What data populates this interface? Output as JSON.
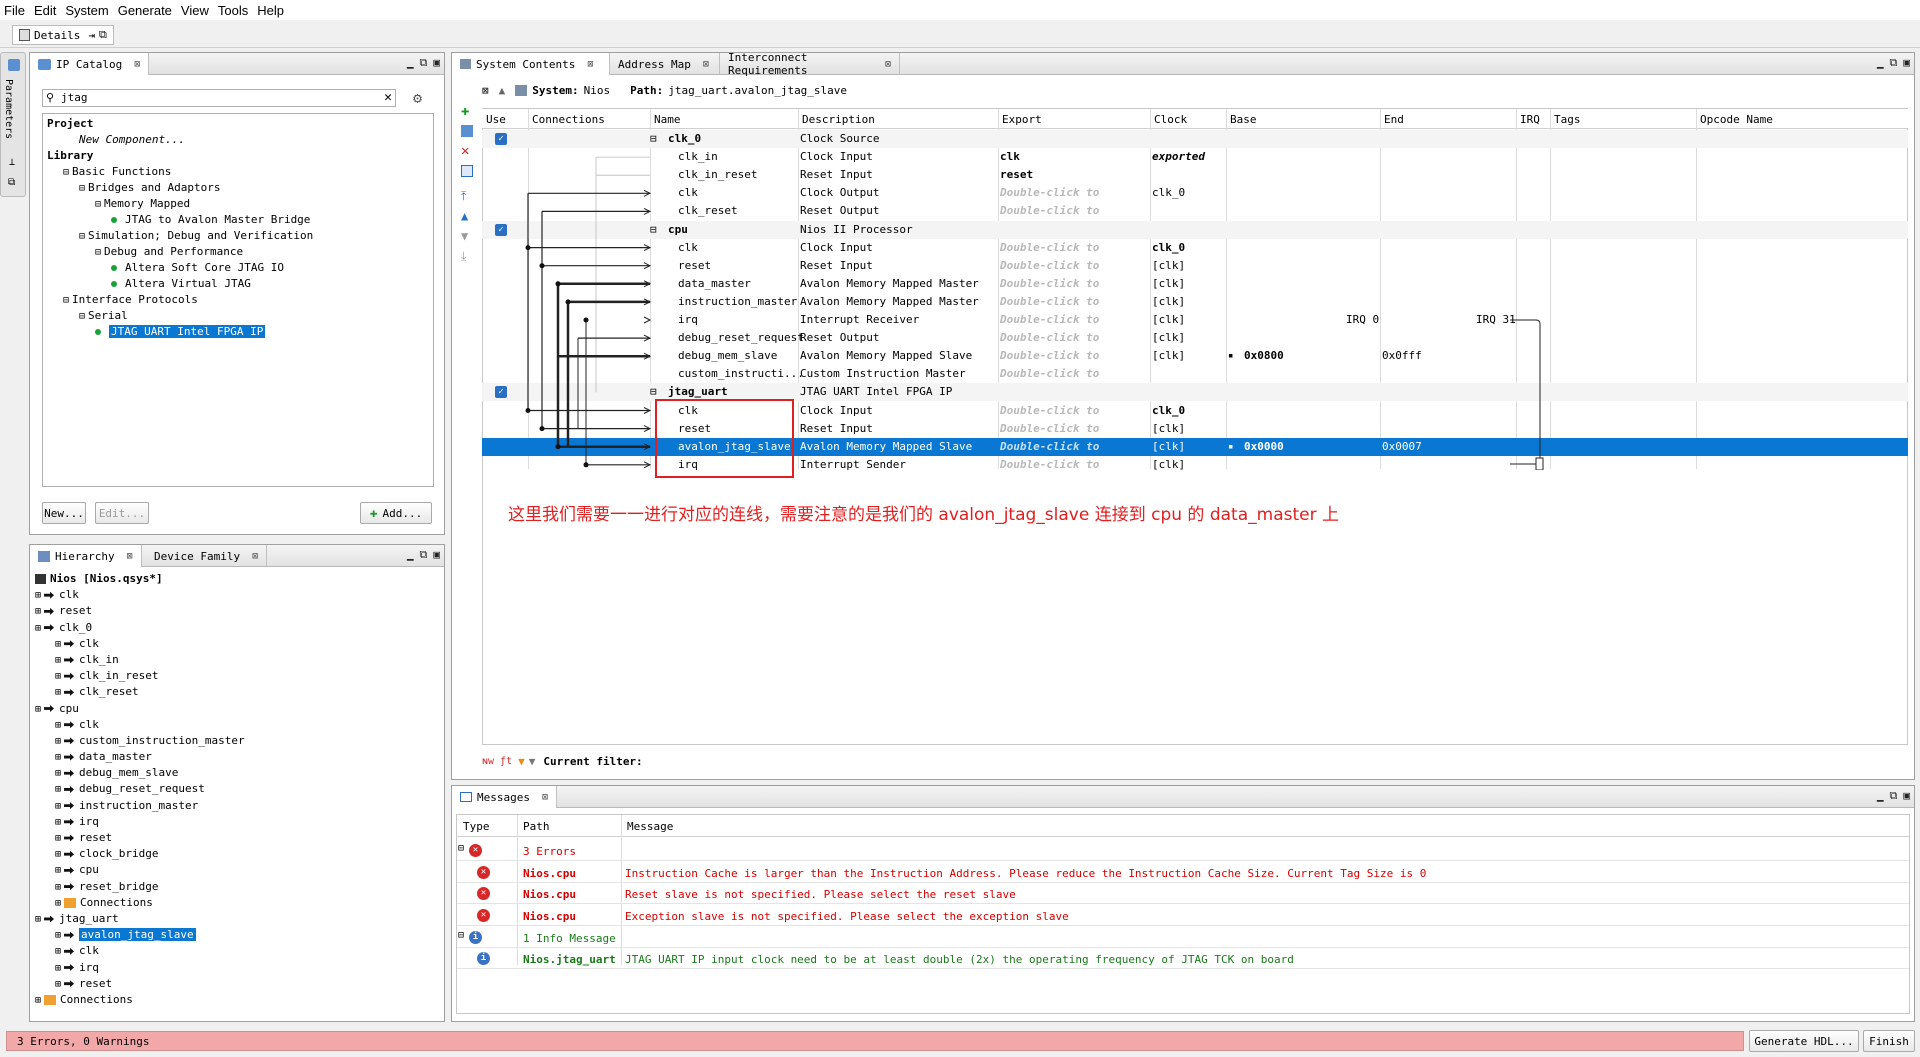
{
  "menu": [
    "File",
    "Edit",
    "System",
    "Generate",
    "View",
    "Tools",
    "Help"
  ],
  "toolbar": {
    "details_tab": "Details"
  },
  "side": {
    "parameters": "Parameters"
  },
  "ip_catalog": {
    "tab": "IP Catalog",
    "search_value": "jtag",
    "tree": [
      {
        "label": "Project",
        "indent": 0,
        "bold": true,
        "exp": ""
      },
      {
        "label": "New Component...",
        "indent": 2,
        "italic": true,
        "exp": ""
      },
      {
        "label": "Library",
        "indent": 0,
        "bold": true,
        "exp": ""
      },
      {
        "label": "Basic Functions",
        "indent": 1,
        "exp": "⊟"
      },
      {
        "label": "Bridges and Adaptors",
        "indent": 2,
        "exp": "⊟"
      },
      {
        "label": "Memory Mapped",
        "indent": 3,
        "exp": "⊟"
      },
      {
        "label": "JTAG to Avalon Master Bridge",
        "indent": 4,
        "dot": true,
        "exp": ""
      },
      {
        "label": "Simulation; Debug and Verification",
        "indent": 2,
        "exp": "⊟"
      },
      {
        "label": "Debug and Performance",
        "indent": 3,
        "exp": "⊟"
      },
      {
        "label": "Altera Soft Core JTAG IO",
        "indent": 4,
        "dot": true,
        "exp": ""
      },
      {
        "label": "Altera Virtual JTAG",
        "indent": 4,
        "dot": true,
        "exp": ""
      },
      {
        "label": "Interface Protocols",
        "indent": 1,
        "exp": "⊟"
      },
      {
        "label": "Serial",
        "indent": 2,
        "exp": "⊟"
      },
      {
        "label": "JTAG UART Intel FPGA IP",
        "indent": 3,
        "dot": true,
        "selected": true,
        "exp": ""
      }
    ],
    "btn_new": "New...",
    "btn_edit": "Edit...",
    "btn_add": "Add..."
  },
  "hierarchy": {
    "tab1": "Hierarchy",
    "tab2": "Device Family",
    "tree": [
      {
        "label": "Nios [Nios.qsys*]",
        "indent": 0,
        "bold": true
      },
      {
        "label": "clk",
        "indent": 0
      },
      {
        "label": "reset",
        "indent": 0
      },
      {
        "label": "clk_0",
        "indent": 0
      },
      {
        "label": "clk",
        "indent": 1
      },
      {
        "label": "clk_in",
        "indent": 1
      },
      {
        "label": "clk_in_reset",
        "indent": 1
      },
      {
        "label": "clk_reset",
        "indent": 1
      },
      {
        "label": "cpu",
        "indent": 0
      },
      {
        "label": "clk",
        "indent": 1
      },
      {
        "label": "custom_instruction_master",
        "indent": 1
      },
      {
        "label": "data_master",
        "indent": 1
      },
      {
        "label": "debug_mem_slave",
        "indent": 1
      },
      {
        "label": "debug_reset_request",
        "indent": 1
      },
      {
        "label": "instruction_master",
        "indent": 1
      },
      {
        "label": "irq",
        "indent": 1
      },
      {
        "label": "reset",
        "indent": 1
      },
      {
        "label": "clock_bridge",
        "indent": 1
      },
      {
        "label": "cpu",
        "indent": 1
      },
      {
        "label": "reset_bridge",
        "indent": 1
      },
      {
        "label": "Connections",
        "indent": 1,
        "folder": true
      },
      {
        "label": "jtag_uart",
        "indent": 0
      },
      {
        "label": "avalon_jtag_slave",
        "indent": 1,
        "selected": true
      },
      {
        "label": "clk",
        "indent": 1
      },
      {
        "label": "irq",
        "indent": 1
      },
      {
        "label": "reset",
        "indent": 1
      },
      {
        "label": "Connections",
        "indent": 0,
        "folder": true
      }
    ]
  },
  "system": {
    "tabs": [
      "System Contents",
      "Address Map",
      "Interconnect Requirements"
    ],
    "system_label": "System:",
    "system_name": "Nios",
    "path_label": "Path:",
    "path_value": "jtag_uart.avalon_jtag_slave",
    "columns": [
      "Use",
      "Connections",
      "Name",
      "Description",
      "Export",
      "Clock",
      "Base",
      "End",
      "IRQ",
      "Tags",
      "Opcode Name"
    ],
    "rows": [
      {
        "use": "✓",
        "exp": "⊟",
        "name": "clk_0",
        "desc": "Clock Source",
        "export": "",
        "clock": "",
        "base": "",
        "end": "",
        "irq": "",
        "group": true
      },
      {
        "name": "clk_in",
        "desc": "Clock Input",
        "export": "clk",
        "clock": "exported",
        "exp_bold": true,
        "clock_italic": true
      },
      {
        "name": "clk_in_reset",
        "desc": "Reset Input",
        "export": "reset",
        "clock": "",
        "exp_bold": true
      },
      {
        "name": "clk",
        "desc": "Clock Output",
        "export": "Double-click to",
        "clock": "clk_0"
      },
      {
        "name": "clk_reset",
        "desc": "Reset Output",
        "export": "Double-click to",
        "clock": ""
      },
      {
        "use": "✓",
        "exp": "⊟",
        "name": "cpu",
        "desc": "Nios II Processor",
        "export": "",
        "clock": "",
        "group": true
      },
      {
        "name": "clk",
        "desc": "Clock Input",
        "export": "Double-click to",
        "clock": "clk_0",
        "clock_bold": true
      },
      {
        "name": "reset",
        "desc": "Reset Input",
        "export": "Double-click to",
        "clock": "[clk]"
      },
      {
        "name": "data_master",
        "desc": "Avalon Memory Mapped Master",
        "export": "Double-click to",
        "clock": "[clk]"
      },
      {
        "name": "instruction_master",
        "desc": "Avalon Memory Mapped Master",
        "export": "Double-click to",
        "clock": "[clk]"
      },
      {
        "name": "irq",
        "desc": "Interrupt Receiver",
        "export": "Double-click to",
        "clock": "[clk]",
        "irq_lo": "IRQ 0",
        "irq_hi": "IRQ 31"
      },
      {
        "name": "debug_reset_request",
        "desc": "Reset Output",
        "export": "Double-click to",
        "clock": "[clk]"
      },
      {
        "name": "debug_mem_slave",
        "desc": "Avalon Memory Mapped Slave",
        "export": "Double-click to",
        "clock": "[clk]",
        "base": "0x0800",
        "end": "0x0fff"
      },
      {
        "name": "custom_instructi...",
        "desc": "Custom Instruction Master",
        "export": "Double-click to",
        "clock": ""
      },
      {
        "use": "✓",
        "exp": "⊟",
        "name": "jtag_uart",
        "desc": "JTAG UART Intel FPGA IP",
        "export": "",
        "clock": "",
        "group": true
      },
      {
        "name": "clk",
        "desc": "Clock Input",
        "export": "Double-click to",
        "clock": "clk_0",
        "clock_bold": true
      },
      {
        "name": "reset",
        "desc": "Reset Input",
        "export": "Double-click to",
        "clock": "[clk]"
      },
      {
        "name": "avalon_jtag_slave",
        "desc": "Avalon Memory Mapped Slave",
        "export": "Double-click to",
        "clock": "[clk]",
        "base": "0x0000",
        "end": "0x0007",
        "selected": true
      },
      {
        "name": "irq",
        "desc": "Interrupt Sender",
        "export": "Double-click to",
        "clock": "[clk]"
      }
    ],
    "annotation": "这里我们需要一一进行对应的连线，需要注意的是我们的 avalon_jtag_slave 连接到 cpu 的 data_master 上",
    "current_filter": "Current filter:"
  },
  "messages": {
    "tab": "Messages",
    "columns": [
      "Type",
      "Path",
      "Message"
    ],
    "rows": [
      {
        "kind": "errgroup",
        "path": "3 Errors",
        "msg": ""
      },
      {
        "kind": "err",
        "path": "Nios.cpu",
        "msg": "Instruction Cache is larger than the Instruction Address. Please reduce the Instruction Cache Size. Current Tag Size is 0"
      },
      {
        "kind": "err",
        "path": "Nios.cpu",
        "msg": "Reset slave is not specified. Please select the reset slave"
      },
      {
        "kind": "err",
        "path": "Nios.cpu",
        "msg": "Exception slave is not specified. Please select the exception slave"
      },
      {
        "kind": "infogroup",
        "path": "1 Info Message",
        "msg": ""
      },
      {
        "kind": "info",
        "path": "Nios.jtag_uart",
        "msg": "JTAG UART IP input clock need to be at least double (2x) the operating frequency of JTAG TCK on board"
      }
    ]
  },
  "status": {
    "text": "3 Errors, 0 Warnings",
    "generate": "Generate HDL...",
    "finish": "Finish"
  },
  "colors": {
    "accent": "#0a78d2",
    "error": "#d40000",
    "status_bg": "#f2a8a8",
    "highlight_box": "#e02020"
  }
}
